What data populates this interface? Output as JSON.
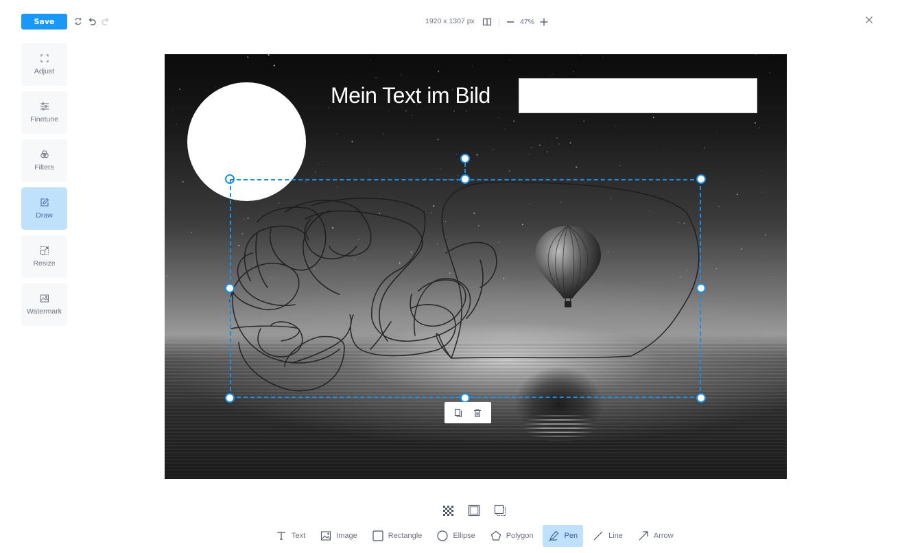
{
  "toolbar": {
    "save_label": "Save",
    "icons": [
      "revert-icon",
      "undo-icon",
      "redo-icon"
    ],
    "dimensions": "1920 x 1307 px",
    "zoom_level": "47%",
    "close_icon": "close-icon"
  },
  "sidebar": {
    "items": [
      {
        "label": "Adjust",
        "icon": "crop-icon",
        "active": false
      },
      {
        "label": "Finetune",
        "icon": "sliders-icon",
        "active": false
      },
      {
        "label": "Filters",
        "icon": "filters-icon",
        "active": false
      },
      {
        "label": "Draw",
        "icon": "edit-icon",
        "active": true
      },
      {
        "label": "Resize",
        "icon": "resize-icon",
        "active": false
      },
      {
        "label": "Watermark",
        "icon": "watermark-icon",
        "active": false
      }
    ]
  },
  "canvas": {
    "overlay_text": "Mein Text im Bild",
    "selection_actions": [
      "duplicate-icon",
      "delete-icon"
    ]
  },
  "style_options": [
    "transparency-icon",
    "stroke-icon",
    "shadow-icon"
  ],
  "tools": [
    {
      "label": "Text",
      "icon": "text-icon",
      "active": false
    },
    {
      "label": "Image",
      "icon": "image-icon",
      "active": false
    },
    {
      "label": "Rectangle",
      "icon": "rectangle-icon",
      "active": false
    },
    {
      "label": "Ellipse",
      "icon": "ellipse-icon",
      "active": false
    },
    {
      "label": "Polygon",
      "icon": "polygon-icon",
      "active": false
    },
    {
      "label": "Pen",
      "icon": "pen-icon",
      "active": true
    },
    {
      "label": "Line",
      "icon": "line-icon",
      "active": false
    },
    {
      "label": "Arrow",
      "icon": "arrow-icon",
      "active": false
    }
  ],
  "colors": {
    "accent": "#1a98f7",
    "selection": "#1a8fe8",
    "active_bg": "#bfe1fc"
  }
}
